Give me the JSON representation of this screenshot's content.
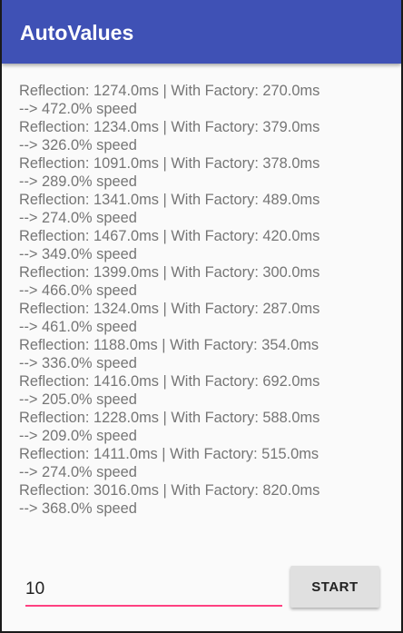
{
  "app_bar": {
    "title": "AutoValues"
  },
  "results": [
    "Reflection: 1274.0ms | With Factory: 270.0ms",
    "--> 472.0% speed",
    "Reflection: 1234.0ms | With Factory: 379.0ms",
    "--> 326.0% speed",
    "Reflection: 1091.0ms | With Factory: 378.0ms",
    "--> 289.0% speed",
    "Reflection: 1341.0ms | With Factory: 489.0ms",
    "--> 274.0% speed",
    "Reflection: 1467.0ms | With Factory: 420.0ms",
    "--> 349.0% speed",
    "Reflection: 1399.0ms | With Factory: 300.0ms",
    "--> 466.0% speed",
    "Reflection: 1324.0ms | With Factory: 287.0ms",
    "--> 461.0% speed",
    "Reflection: 1188.0ms | With Factory: 354.0ms",
    "--> 336.0% speed",
    "Reflection: 1416.0ms | With Factory: 692.0ms",
    "--> 205.0% speed",
    "Reflection: 1228.0ms | With Factory: 588.0ms",
    "--> 209.0% speed",
    "Reflection: 1411.0ms | With Factory: 515.0ms",
    "--> 274.0% speed",
    "Reflection: 3016.0ms | With Factory: 820.0ms",
    "--> 368.0% speed"
  ],
  "controls": {
    "count_value": "10",
    "start_label": "START"
  },
  "colors": {
    "primary": "#3f51b5",
    "accent": "#ff4081",
    "button": "#e0e0e0"
  }
}
